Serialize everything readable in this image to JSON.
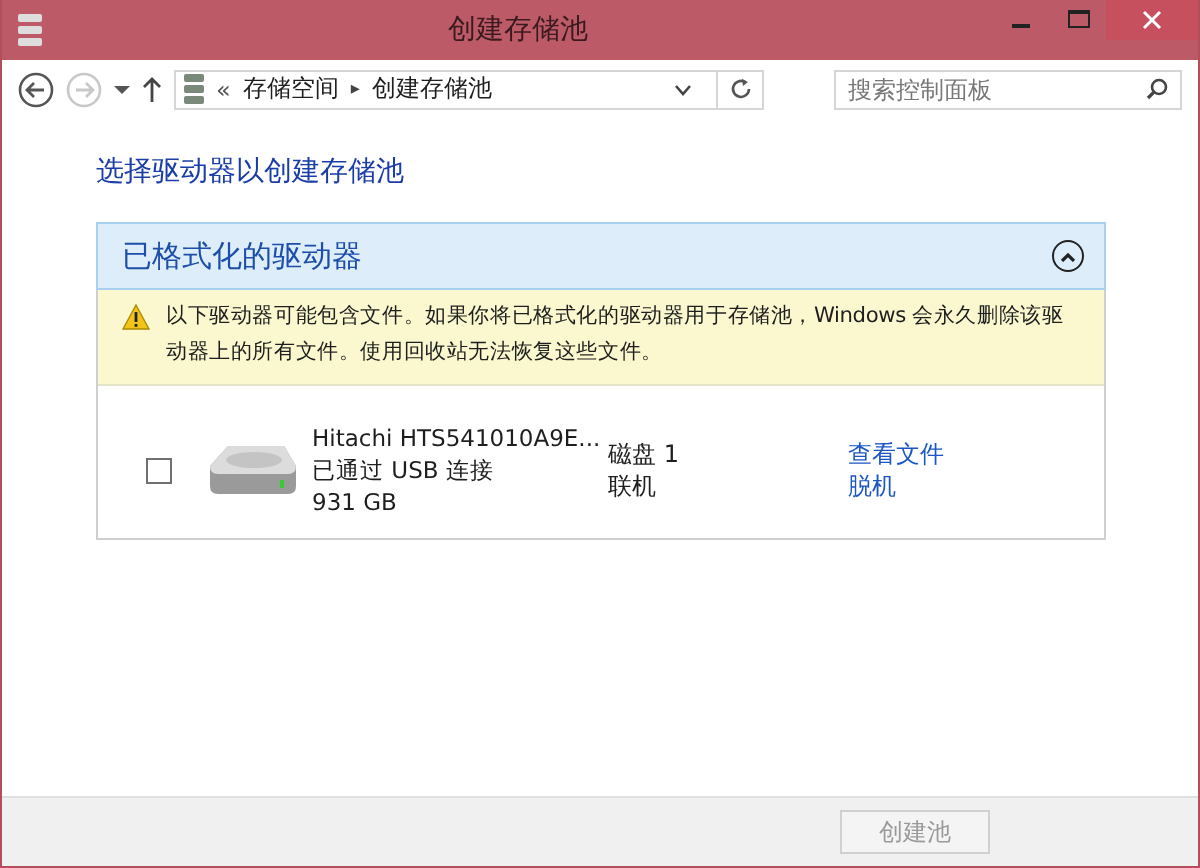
{
  "window": {
    "title": "创建存储池"
  },
  "address_bar": {
    "path": [
      {
        "kind": "overflow",
        "label": "«"
      },
      {
        "kind": "segment",
        "label": "存储空间"
      },
      {
        "kind": "separator",
        "label": "▸"
      },
      {
        "kind": "segment",
        "label": "创建存储池"
      }
    ]
  },
  "search": {
    "placeholder": "搜索控制面板"
  },
  "heading": "选择驱动器以创建存储池",
  "group": {
    "title": "已格式化的驱动器",
    "expanded": true,
    "warning": "以下驱动器可能包含文件。如果你将已格式化的驱动器用于存储池，Windows 会永久删除该驱动器上的所有文件。使用回收站无法恢复这些文件。",
    "drives": [
      {
        "checked": false,
        "name": "Hitachi HTS541010A9E...",
        "connection": "已通过 USB 连接",
        "size": "931 GB",
        "disk": "磁盘 1",
        "status": "联机",
        "links": [
          "查看文件",
          "脱机"
        ]
      }
    ]
  },
  "buttons": [
    {
      "label": "创建池",
      "disabled": true
    }
  ]
}
